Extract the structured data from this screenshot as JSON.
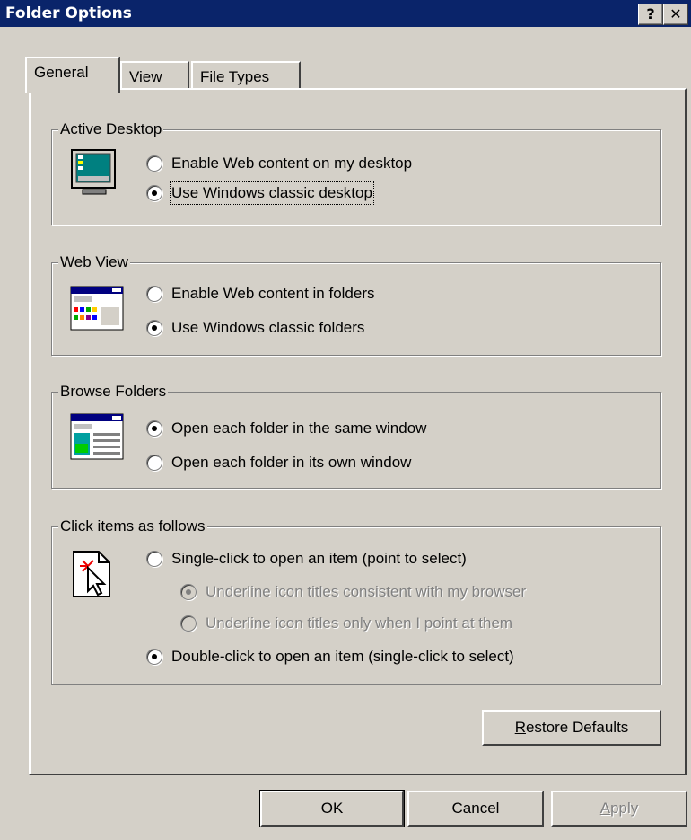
{
  "window": {
    "title": "Folder Options",
    "help_glyph": "?",
    "close_glyph": "✕"
  },
  "tabs": [
    {
      "label": "General",
      "active": true
    },
    {
      "label": "View",
      "active": false
    },
    {
      "label": "File Types",
      "active": false
    }
  ],
  "active_desktop": {
    "legend": "Active Desktop",
    "icon": "monitor-icon",
    "options": [
      {
        "label": "Enable Web content on my desktop",
        "checked": false
      },
      {
        "label": "Use Windows classic desktop",
        "checked": true
      }
    ]
  },
  "web_view": {
    "legend": "Web View",
    "icon": "web-folder-icon",
    "options": [
      {
        "label": "Enable Web content in folders",
        "checked": false
      },
      {
        "label": "Use Windows classic folders",
        "checked": true
      }
    ]
  },
  "browse_folders": {
    "legend": "Browse Folders",
    "icon": "window-icon",
    "options": [
      {
        "label": "Open each folder in the same window",
        "checked": true
      },
      {
        "label": "Open each folder in its own window",
        "checked": false
      }
    ]
  },
  "click_items": {
    "legend": "Click items as follows",
    "icon": "pointer-click-icon",
    "single_click": {
      "label": "Single-click to open an item (point to select)",
      "checked": false
    },
    "underline_browser": {
      "label": "Underline icon titles consistent with my browser",
      "checked": true,
      "disabled": true
    },
    "underline_point": {
      "label": "Underline icon titles only when I point at them",
      "checked": false,
      "disabled": true
    },
    "double_click": {
      "label": "Double-click to open an item (single-click to select)",
      "checked": true
    }
  },
  "buttons": {
    "restore_mnemonic": "R",
    "restore_rest": "estore Defaults",
    "ok": "OK",
    "cancel": "Cancel",
    "apply_mnemonic": "A",
    "apply_rest": "pply"
  }
}
